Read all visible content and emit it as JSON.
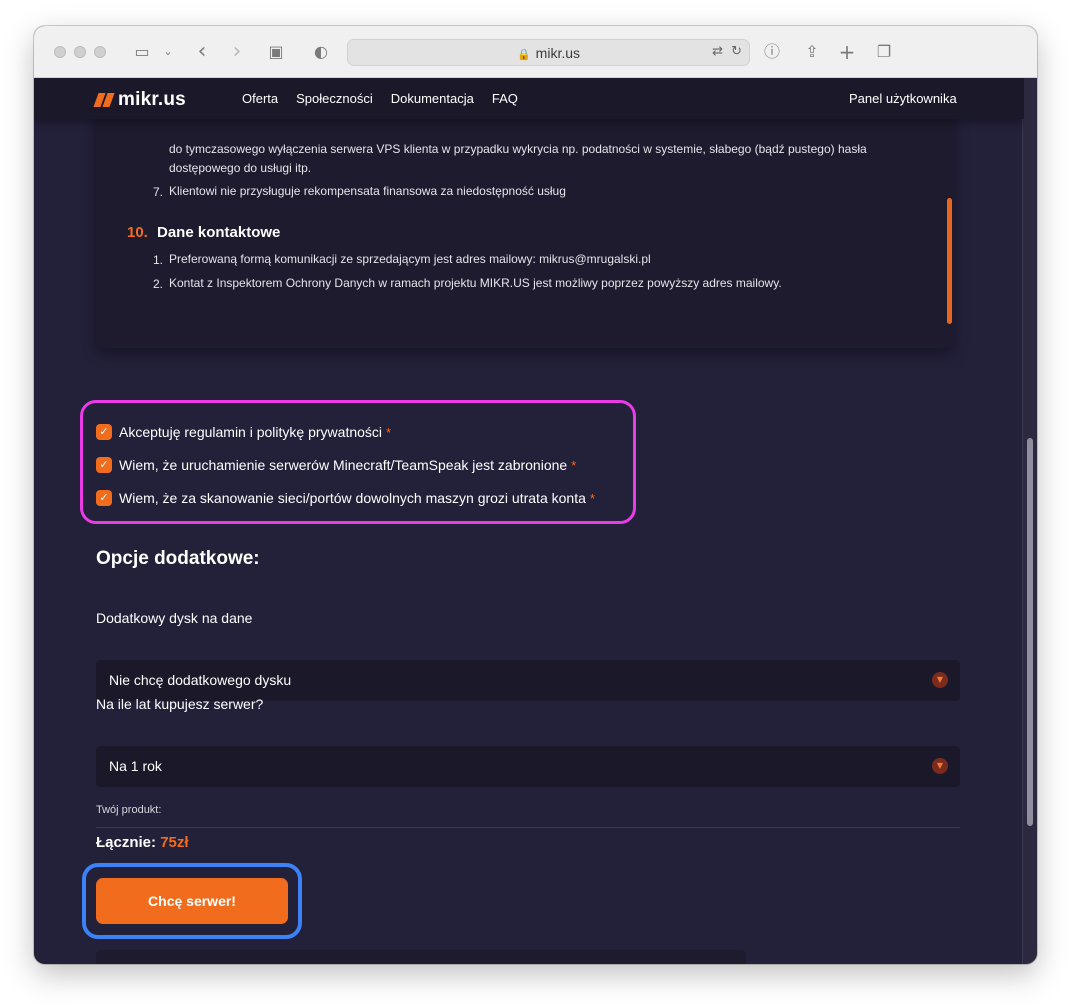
{
  "browser": {
    "url": "mikr.us"
  },
  "nav": {
    "logo": "mikr.us",
    "links": [
      "Oferta",
      "Społeczności",
      "Dokumentacja",
      "FAQ"
    ],
    "panel": "Panel użytkownika"
  },
  "terms": {
    "item6_line1": "do tymczasowego wyłączenia serwera VPS klienta w przypadku wykrycia np. podatności w systemie, słabego (bądź pustego) hasła",
    "item6_line2": "dostępowego do usługi itp.",
    "item7_num": "7.",
    "item7": "Klientowi nie przysługuje rekompensata finansowa za niedostępność usług",
    "section_num": "10.",
    "section_title": "Dane kontaktowe",
    "contact1_num": "1.",
    "contact1": "Preferowaną formą komunikacji ze sprzedającym jest adres mailowy: mikrus@mrugalski.pl",
    "contact2_num": "2.",
    "contact2": "Kontat z Inspektorem Ochrony Danych w ramach projektu MIKR.US jest możliwy poprzez powyższy adres mailowy."
  },
  "checks": [
    {
      "label": "Akceptuję regulamin i politykę prywatności",
      "required": "*",
      "checked": true
    },
    {
      "label": "Wiem, że uruchamienie serwerów Minecraft/TeamSpeak jest zabronione",
      "required": "*",
      "checked": true
    },
    {
      "label": "Wiem, że za skanowanie sieci/portów dowolnych maszyn grozi utrata konta",
      "required": "*",
      "checked": true
    }
  ],
  "options": {
    "heading": "Opcje dodatkowe:",
    "disk_label": "Dodatkowy dysk na dane",
    "disk_value": "Nie chcę dodatkowego dysku",
    "years_label": "Na ile lat kupujesz serwer?",
    "years_value": "Na 1 rok"
  },
  "summary": {
    "product_label": "Twój produkt:",
    "total_label": "Łącznie:",
    "total_price": "75zł"
  },
  "cta": {
    "label": "Chcę serwer!"
  },
  "colors": {
    "accent": "#f26c1d",
    "background": "#23203a",
    "highlight_pink": "#e93ce6",
    "highlight_blue": "#3b82f6"
  }
}
